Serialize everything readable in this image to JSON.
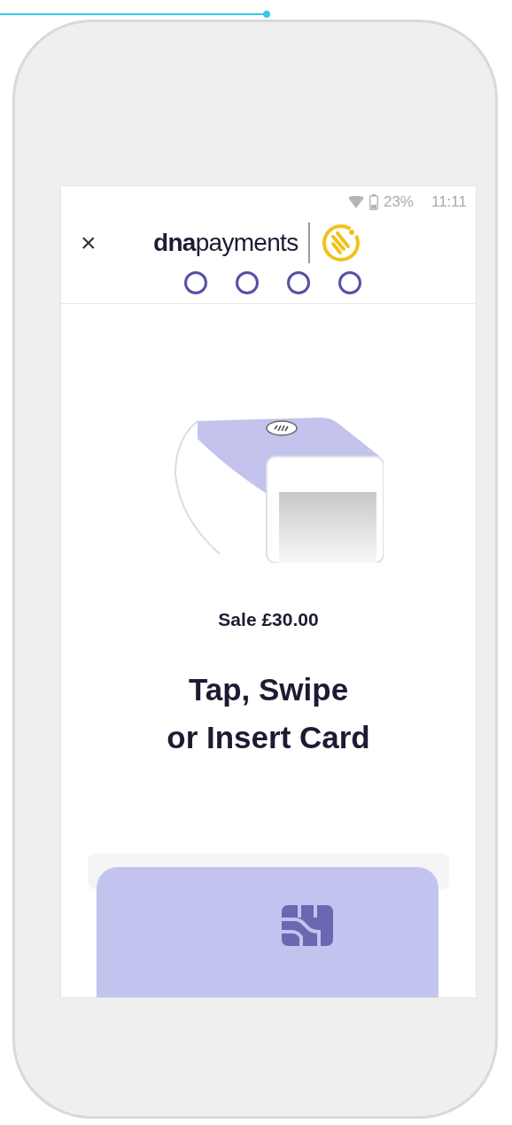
{
  "status_bar": {
    "battery": "23%",
    "time": "11:11"
  },
  "header": {
    "close": "×",
    "logo": "**dna**payments"
  },
  "steps": [
    {
      "selected": false
    },
    {
      "selected": false
    },
    {
      "selected": false
    },
    {
      "selected": false
    }
  ],
  "transaction": {
    "label": "Sale £30.00"
  },
  "prompt": {
    "lines": [
      "Tap, Swipe",
      "or Insert Card"
    ]
  }
}
